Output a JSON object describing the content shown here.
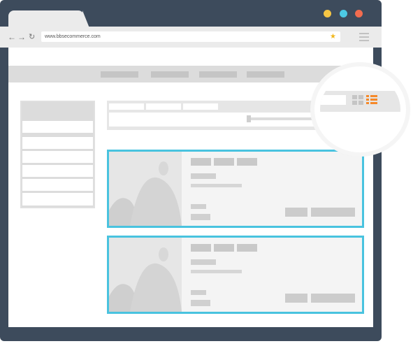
{
  "browser": {
    "url": "www.bbsecommerce.com",
    "back_icon": "arrow-left-icon",
    "forward_icon": "arrow-right-icon",
    "reload_icon": "reload-icon",
    "bookmark_icon": "star-icon",
    "menu_icon": "hamburger-icon",
    "traffic_lights": [
      "#f6c644",
      "#4cc9e4",
      "#f26c4f"
    ]
  },
  "colors": {
    "frame": "#3d4b5c",
    "highlight": "#49c3df",
    "list_icon_active": "#f5892a"
  },
  "view_toggle": {
    "grid_icon": "grid-view-icon",
    "list_icon": "list-view-icon",
    "active": "list"
  }
}
